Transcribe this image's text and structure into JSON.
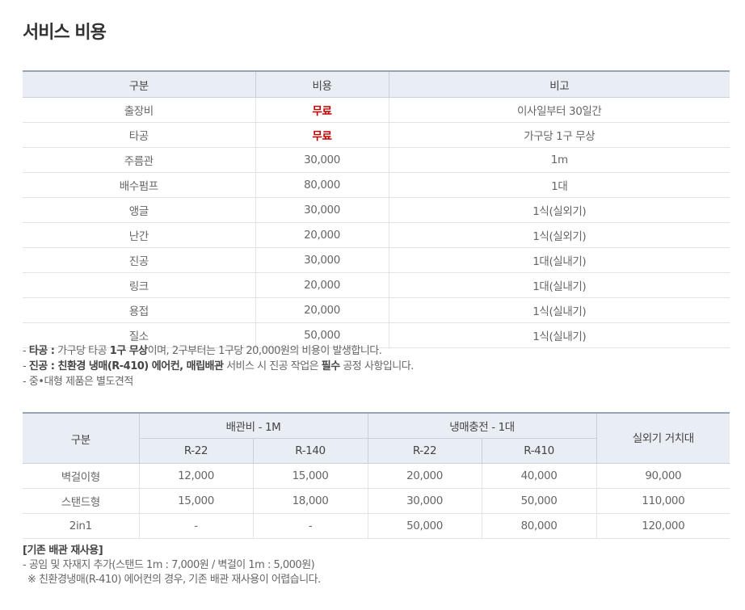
{
  "page_title": "서비스 비용",
  "table1": {
    "headers": [
      "구분",
      "비용",
      "비고"
    ],
    "rows": [
      [
        "출장비",
        "무료",
        "이사일부터 30일간"
      ],
      [
        "타공",
        "무료",
        "가구당 1구 무상"
      ],
      [
        "주름관",
        "30,000",
        "1m"
      ],
      [
        "배수펌프",
        "80,000",
        "1대"
      ],
      [
        "앵글",
        "30,000",
        "1식(실외기)"
      ],
      [
        "난간",
        "20,000",
        "1식(실외기)"
      ],
      [
        "진공",
        "30,000",
        "1대(실내기)"
      ],
      [
        "링크",
        "20,000",
        "1대(실내기)"
      ],
      [
        "용접",
        "20,000",
        "1식(실내기)"
      ],
      [
        "질소",
        "50,000",
        "1식(실내기)"
      ]
    ]
  },
  "notes1": {
    "line1": {
      "prefix": "- ",
      "label": "타공 :",
      "t1": " 가구당 타공 ",
      "bold1": "1구 무상",
      "t2": "이며, 2구부터는 1구당 20,000원의 비용이 발생합니다."
    },
    "line2": {
      "prefix": "- ",
      "label": "진공 : 친환경 냉매(R-410) 에어컨, 매립배관",
      "t1": " 서비스 시 진공 작업은 ",
      "bold1": "필수",
      "t2": " 공정 사항입니다."
    },
    "line3": "- 중•대형 제품은 별도견적"
  },
  "table2": {
    "header_category": "구분",
    "group1": "배관비 - 1M",
    "group2": "냉매충전 - 1대",
    "outdoor_stand": "실외기 거치대",
    "sub_headers": [
      "R-22",
      "R-140",
      "R-22",
      "R-410"
    ],
    "rows": [
      [
        "벽걸이형",
        "12,000",
        "15,000",
        "20,000",
        "40,000",
        "90,000"
      ],
      [
        "스탠드형",
        "15,000",
        "18,000",
        "30,000",
        "50,000",
        "110,000"
      ],
      [
        "2in1",
        "-",
        "-",
        "50,000",
        "80,000",
        "120,000"
      ]
    ]
  },
  "notes2": {
    "heading": "[기존 배관 재사용]",
    "line1": "- 공임 및 자재지 추가(스탠드 1m : 7,000원 / 벽걸이 1m : 5,000원)",
    "line2": "※ 친환경냉매(R-410) 에어컨의 경우, 기존 배관 재사용이 어렵습니다."
  },
  "colors": {
    "header_bg": "#e9eef5",
    "header_top_border": "#97a4b4",
    "free_text": "#c00000"
  }
}
